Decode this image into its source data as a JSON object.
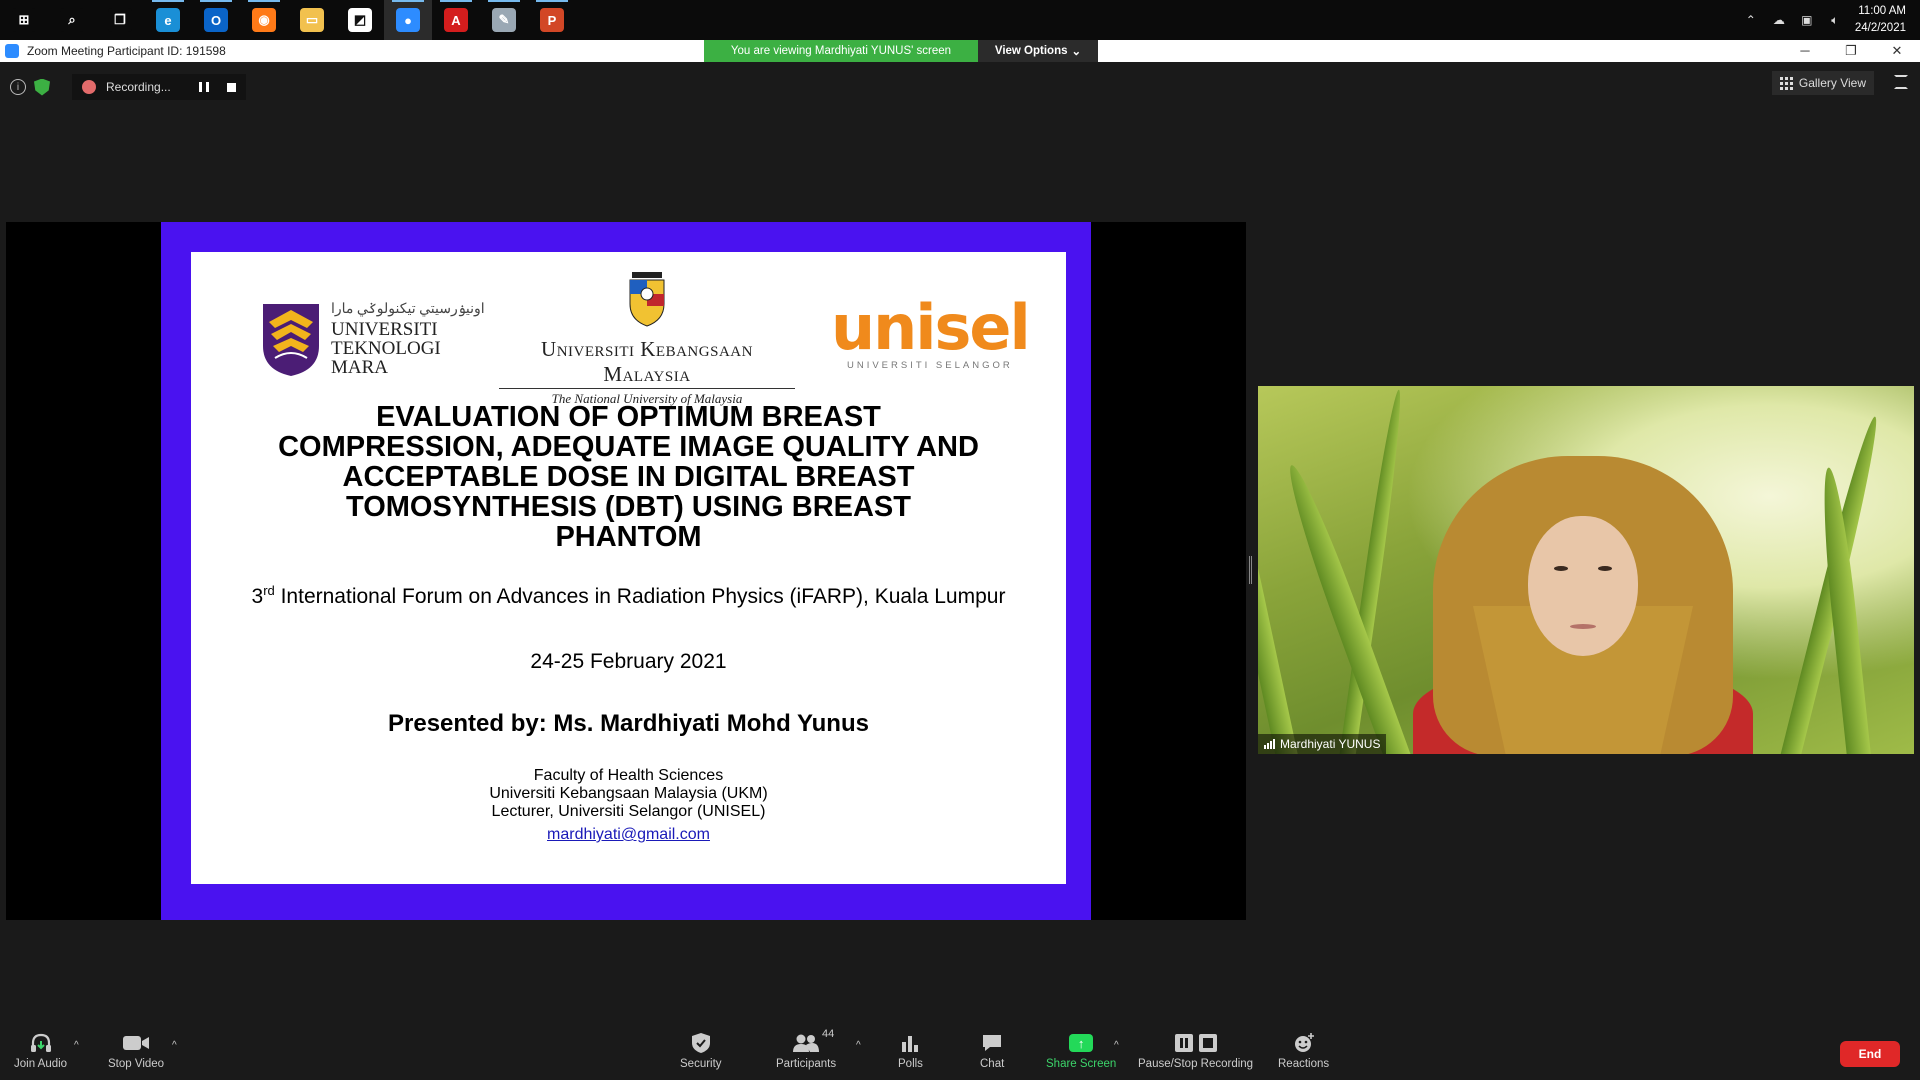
{
  "taskbar": {
    "apps": [
      {
        "name": "start-icon",
        "glyph": "⊞",
        "color": "#0b0b0b"
      },
      {
        "name": "search-icon",
        "glyph": "⌕",
        "color": "#0b0b0b"
      },
      {
        "name": "task-view-icon",
        "glyph": "❐",
        "color": "#0b0b0b"
      },
      {
        "name": "edge-icon",
        "glyph": "e",
        "color": "#1a8fd6"
      },
      {
        "name": "outlook-icon",
        "glyph": "O",
        "color": "#0a64c8"
      },
      {
        "name": "firefox-icon",
        "glyph": "◉",
        "color": "#ff7a18"
      },
      {
        "name": "file-explorer-icon",
        "glyph": "▭",
        "color": "#f2c14e"
      },
      {
        "name": "sticky-app-icon",
        "glyph": "◩",
        "color": "#ffffff"
      },
      {
        "name": "zoom-app-icon",
        "glyph": "●",
        "color": "#2d8cff"
      },
      {
        "name": "acrobat-icon",
        "glyph": "A",
        "color": "#d41d1d"
      },
      {
        "name": "paint-icon",
        "glyph": "✎",
        "color": "#9aa8b4"
      },
      {
        "name": "powerpoint-icon",
        "glyph": "P",
        "color": "#d24726"
      }
    ],
    "clock_time": "11:00 AM",
    "clock_date": "24/2/2021"
  },
  "titlebar": {
    "title": "Zoom Meeting Participant ID: 191598",
    "viewing_banner": "You are viewing Mardhiyati YUNUS' screen",
    "view_options": "View Options"
  },
  "meeting_top": {
    "recording_label": "Recording...",
    "gallery_view": "Gallery View"
  },
  "slide": {
    "uitm_jawi": "اونيۏرسيتي تيکنولوݢي مارا",
    "uitm_lines": [
      "UNIVERSITI",
      "TEKNOLOGI",
      "MARA"
    ],
    "ukm_name": "Universiti Kebangsaan Malaysia",
    "ukm_sub": "The National University of Malaysia",
    "unisel_name": "unisel",
    "unisel_sub": "UNIVERSITI SELANGOR",
    "title": "EVALUATION OF OPTIMUM BREAST COMPRESSION, ADEQUATE IMAGE QUALITY AND ACCEPTABLE DOSE IN DIGITAL BREAST TOMOSYNTHESIS (DBT) USING BREAST PHANTOM",
    "conf_ordinal": "3",
    "conf_sup": "rd",
    "conf_text": " International Forum on Advances in Radiation Physics (iFARP), Kuala Lumpur",
    "date": "24-25 February 2021",
    "presenter": "Presented by: Ms. Mardhiyati Mohd Yunus",
    "faculty_lines": [
      "Faculty of Health Sciences",
      "Universiti Kebangsaan Malaysia (UKM)",
      "Lecturer, Universiti Selangor (UNISEL)"
    ],
    "email": "mardhiyati@gmail.com"
  },
  "video": {
    "participant_name": "Mardhiyati YUNUS"
  },
  "toolbar": {
    "join_audio": "Join Audio",
    "stop_video": "Stop Video",
    "security": "Security",
    "participants": "Participants",
    "participant_count": "44",
    "polls": "Polls",
    "chat": "Chat",
    "share_screen": "Share Screen",
    "pause_stop_recording": "Pause/Stop Recording",
    "reactions": "Reactions",
    "end": "End"
  },
  "colors": {
    "slide_border": "#4a12f0",
    "banner_green": "#3cb043",
    "unisel_orange": "#f08a1c",
    "end_red": "#e02828"
  }
}
